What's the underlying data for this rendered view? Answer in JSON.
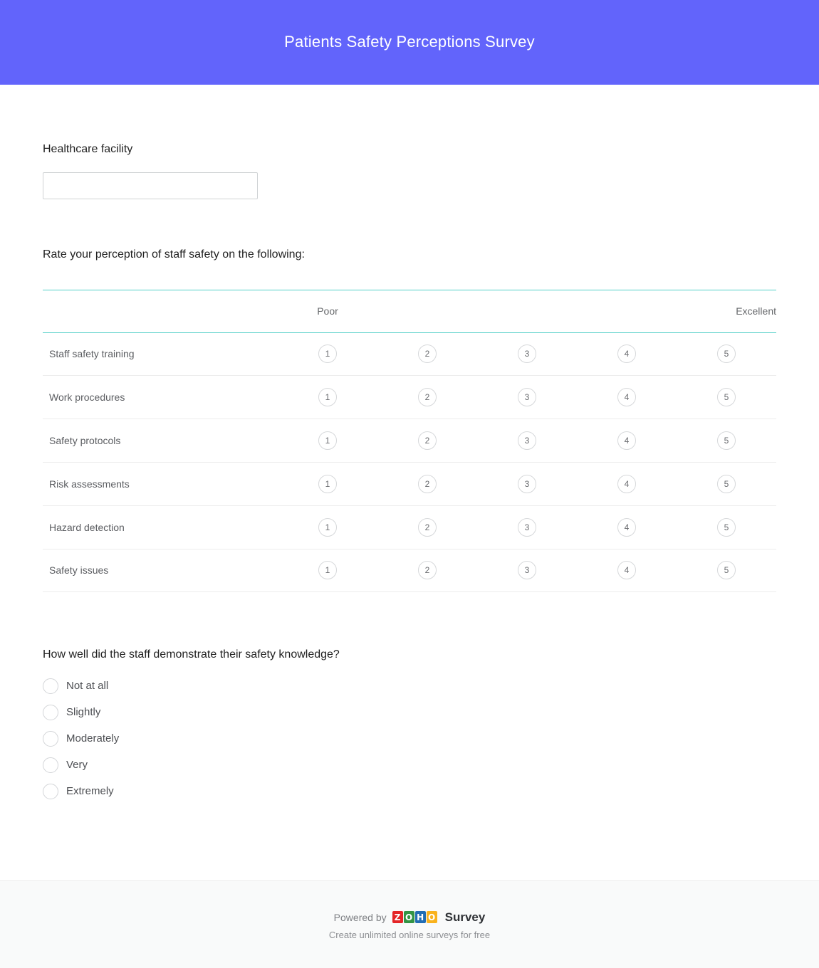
{
  "header": {
    "title": "Patients Safety Perceptions Survey",
    "background_color": "#6264fb",
    "text_color": "#ffffff"
  },
  "questions": {
    "facility": {
      "label": "Healthcare facility",
      "input_value": "",
      "input_placeholder": ""
    },
    "matrix": {
      "label": "Rate your perception of staff safety on the following:",
      "left_anchor": "Poor",
      "right_anchor": "Excellent",
      "accent_color": "#53cfc8",
      "scale": [
        "1",
        "2",
        "3",
        "4",
        "5"
      ],
      "rows": [
        {
          "label": "Staff safety training"
        },
        {
          "label": "Work procedures"
        },
        {
          "label": "Safety protocols"
        },
        {
          "label": "Risk assessments"
        },
        {
          "label": "Hazard detection"
        },
        {
          "label": "Safety issues"
        }
      ]
    },
    "knowledge": {
      "label": "How well did the staff demonstrate their safety knowledge?",
      "options": [
        {
          "label": "Not at all"
        },
        {
          "label": "Slightly"
        },
        {
          "label": "Moderately"
        },
        {
          "label": "Very"
        },
        {
          "label": "Extremely"
        }
      ]
    }
  },
  "footer": {
    "powered_by": "Powered by",
    "brand_tiles": [
      {
        "letter": "Z",
        "color": "#e42527"
      },
      {
        "letter": "O",
        "color": "#339444"
      },
      {
        "letter": "H",
        "color": "#226db4"
      },
      {
        "letter": "O",
        "color": "#f9b21d"
      }
    ],
    "product": "Survey",
    "tagline": "Create unlimited online surveys for free"
  }
}
